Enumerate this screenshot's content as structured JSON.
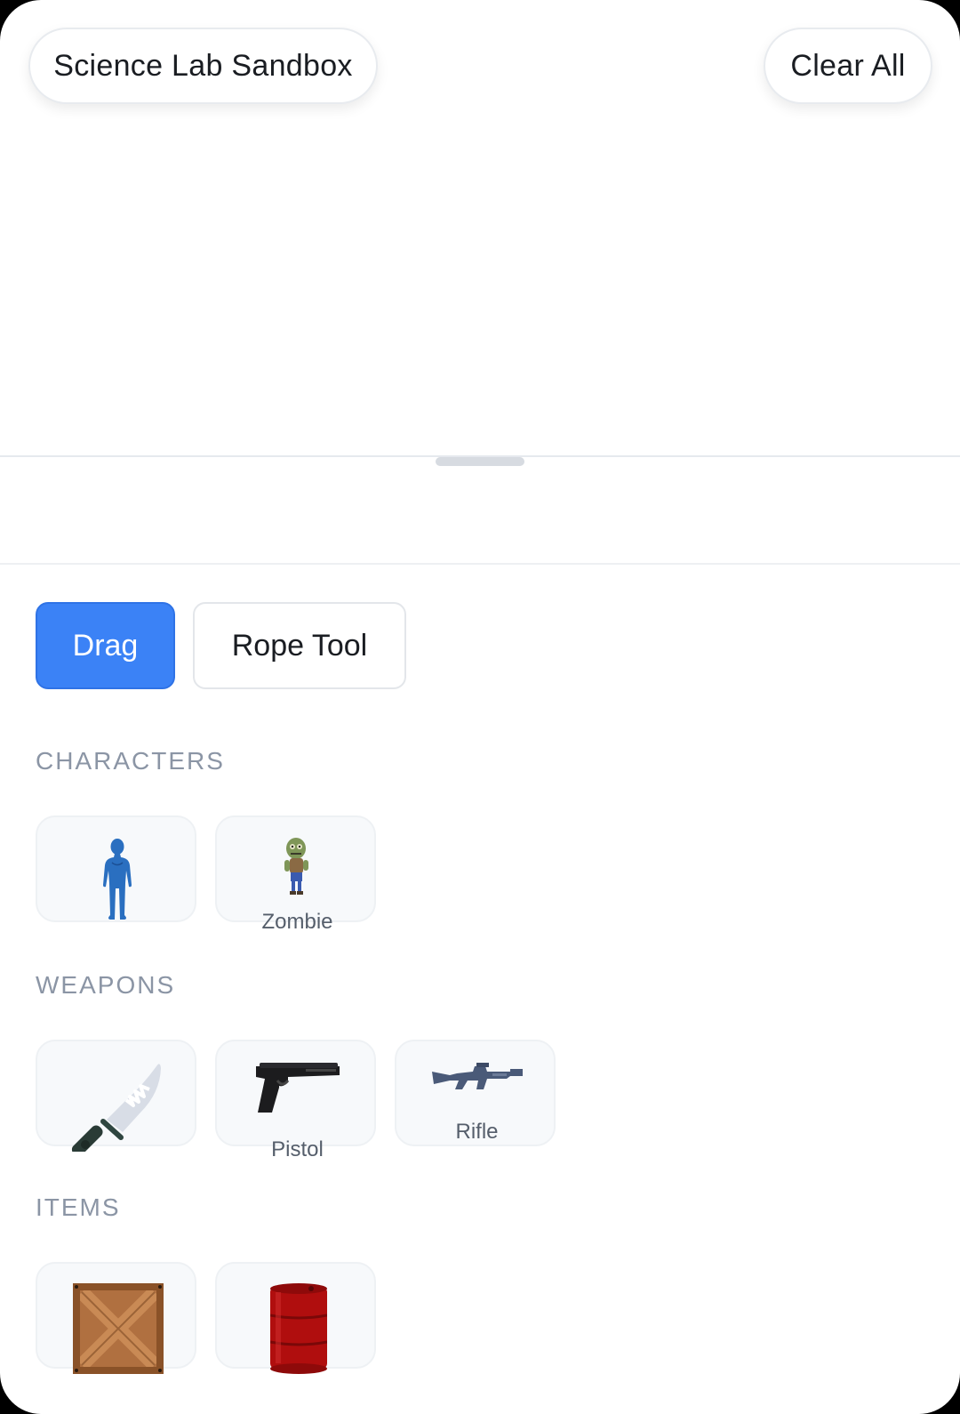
{
  "header": {
    "title": "Science Lab Sandbox",
    "clear_label": "Clear All"
  },
  "modes": {
    "drag_label": "Drag",
    "rope_label": "Rope Tool",
    "active": "Drag"
  },
  "sections": {
    "characters": {
      "title": "CHARACTERS",
      "items": [
        {
          "label": "",
          "icon": "human-figure-icon"
        },
        {
          "label": "Zombie",
          "icon": "zombie-icon"
        }
      ]
    },
    "weapons": {
      "title": "WEAPONS",
      "items": [
        {
          "label": "",
          "icon": "knife-icon"
        },
        {
          "label": "Pistol",
          "icon": "pistol-icon"
        },
        {
          "label": "Rifle",
          "icon": "rifle-icon"
        }
      ]
    },
    "items": {
      "title": "ITEMS",
      "items": [
        {
          "label": "",
          "icon": "crate-icon"
        },
        {
          "label": "",
          "icon": "barrel-icon"
        }
      ]
    }
  },
  "colors": {
    "accent": "#3b82f6",
    "section_title": "#8b95a5",
    "background": "#ffffff"
  }
}
